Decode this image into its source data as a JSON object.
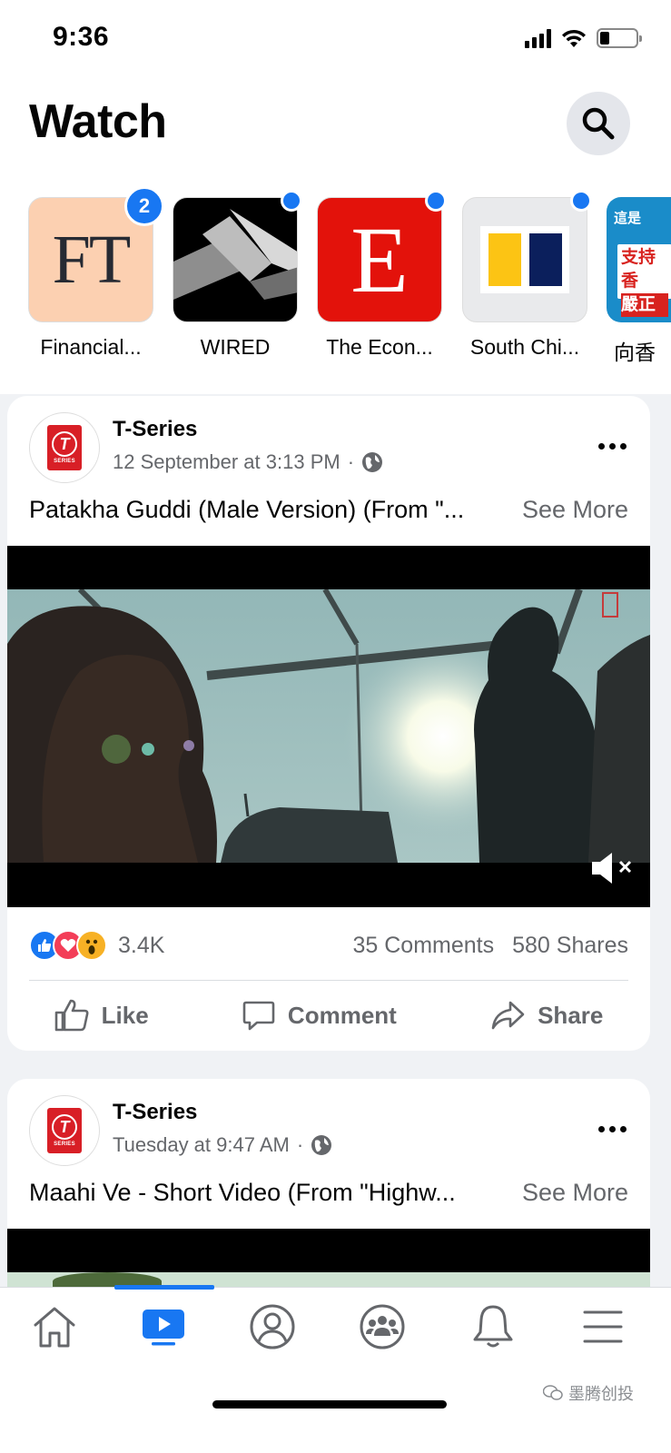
{
  "status_bar": {
    "time": "9:36"
  },
  "header": {
    "title": "Watch",
    "search_icon": "search-icon"
  },
  "channels": [
    {
      "name": "Financial...",
      "badge": "2",
      "logo_text": "FT"
    },
    {
      "name": "WIRED",
      "badge": ""
    },
    {
      "name": "The Econ...",
      "badge": "",
      "logo_text": "E"
    },
    {
      "name": "South Chi...",
      "badge": ""
    },
    {
      "name": "向香",
      "badge": "",
      "logo_lines": [
        "這是",
        "支持香",
        "嚴正"
      ]
    }
  ],
  "posts": [
    {
      "author": "T-Series",
      "timestamp": "12 September at 3:13 PM",
      "separator": "·",
      "caption": "Patakha Guddi (Male Version) (From \"...",
      "see_more": "See More",
      "reaction_count": "3.4K",
      "comments": "35 Comments",
      "shares": "580 Shares",
      "actions": {
        "like": "Like",
        "comment": "Comment",
        "share": "Share"
      }
    },
    {
      "author": "T-Series",
      "timestamp": "Tuesday at 9:47 AM",
      "separator": "·",
      "caption": "Maahi Ve - Short Video (From \"Highw...",
      "see_more": "See More"
    }
  ],
  "avatar_logo": {
    "letter": "T",
    "subtext": "SERIES"
  },
  "bottom_nav": {
    "items": [
      "home-icon",
      "watch-icon",
      "profile-icon",
      "groups-icon",
      "notifications-icon",
      "menu-icon"
    ],
    "active": "watch-icon"
  },
  "watermark": "墨腾创投",
  "colors": {
    "accent": "#1877f2",
    "secondary_text": "#65676b",
    "like_blue": "#1877f2",
    "love_red": "#f33e58",
    "wow_yellow": "#f7b125"
  }
}
